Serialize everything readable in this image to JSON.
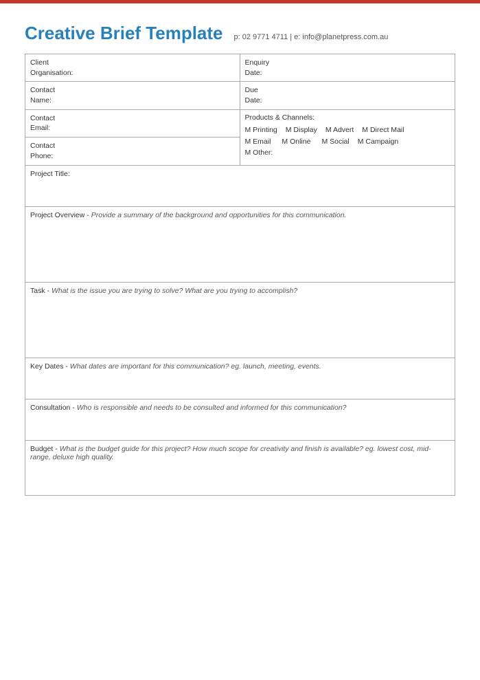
{
  "page": {
    "topbar_color": "#c0392b"
  },
  "header": {
    "title": "Creative Brief Template",
    "contact": "p: 02 9771 4711 | e: info@planetpress.com.au"
  },
  "left_fields": [
    {
      "label": "Client\nOrganisation:"
    },
    {
      "label": "Contact\nName:"
    },
    {
      "label": "Contact\nEmail:"
    },
    {
      "label": "Contact\nPhone:"
    }
  ],
  "right_fields": [
    {
      "label": "Enquiry\nDate:"
    },
    {
      "label": "Due\nDate:"
    }
  ],
  "products": {
    "label": "Products & Channels:",
    "row1": [
      "M Printing",
      "M Display",
      "M Advert",
      "M Direct Mail"
    ],
    "row2": [
      "M Email",
      "M Online",
      "M Social",
      "M Campaign"
    ],
    "row3": [
      "M Other:"
    ]
  },
  "sections": {
    "project_title": {
      "label": "Project Title:"
    },
    "project_overview": {
      "label": "Project Overview",
      "italic": "Provide a summary of the background and opportunities for this communication."
    },
    "task": {
      "label": "Task",
      "italic": "What is the issue you are trying to solve? What are you trying to accomplish?"
    },
    "key_dates": {
      "label": "Key Dates",
      "italic": "What dates are important for this communication? eg. launch, meeting, events."
    },
    "consultation": {
      "label": "Consultation",
      "italic": "Who is responsible and needs to be consulted and informed for this communication?"
    },
    "budget": {
      "label": "Budget",
      "italic": "What is the budget guide for this project? How much scope for creativity and finish is available? eg. lowest cost, mid-range, deluxe high quality."
    }
  }
}
